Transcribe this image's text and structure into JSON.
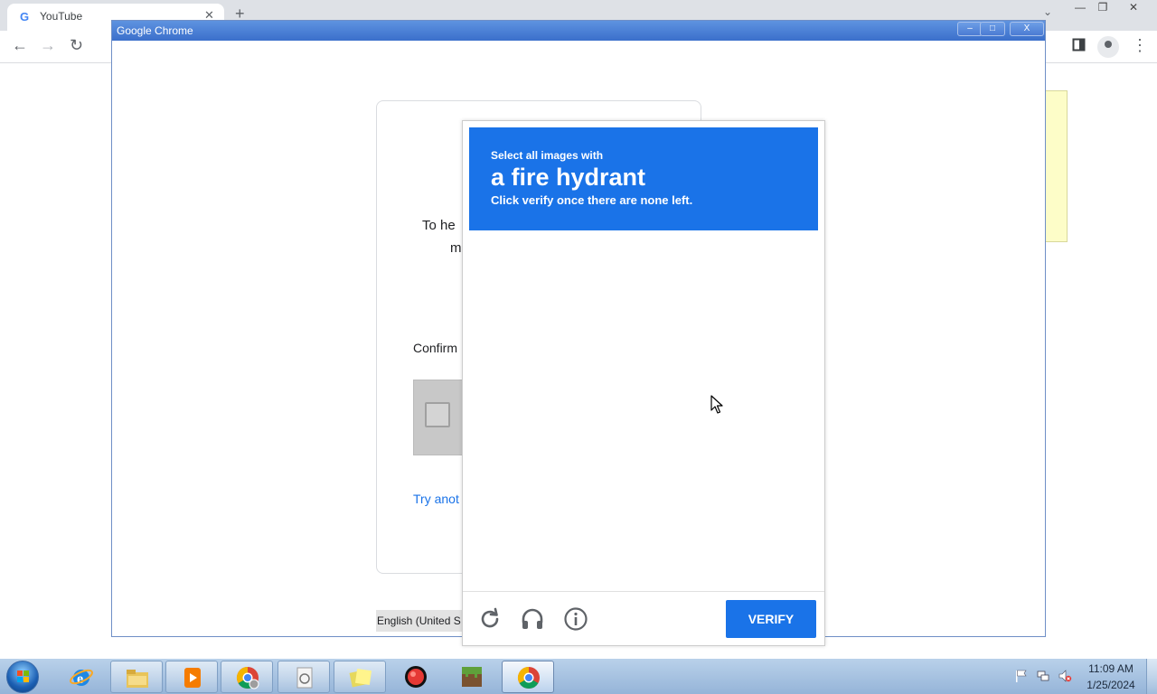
{
  "browser": {
    "tab_favicon": "G",
    "tab_title": "YouTube",
    "tab_close": "✕",
    "new_tab": "+",
    "tab_search": "⌄",
    "minimize": "—",
    "restore": "❐",
    "close": "✕",
    "back": "←",
    "forward": "→",
    "reload": "↻",
    "menu": "⋮"
  },
  "popup": {
    "title": "Google Chrome",
    "minimize": "–",
    "maximize": "□",
    "close": "X"
  },
  "page": {
    "desc_line1": "To he",
    "desc_line2": "m",
    "confirm_label": "Confirm",
    "try_another": "Try anot",
    "language": "English (United S"
  },
  "challenge": {
    "subtitle": "Select all images with",
    "object": "a fire hydrant",
    "hint": "Click verify once there are none left.",
    "verify_label": "VERIFY",
    "icons": [
      "reload-icon",
      "headphones-icon",
      "info-icon"
    ],
    "accent_color": "#1a73e8"
  },
  "taskbar": {
    "apps": [
      "internet-explorer",
      "file-explorer",
      "media-player",
      "chrome-profile",
      "document",
      "sticky-notes",
      "red-ball-app",
      "minecraft",
      "chrome"
    ],
    "time": "11:09 AM",
    "date": "1/25/2024"
  }
}
